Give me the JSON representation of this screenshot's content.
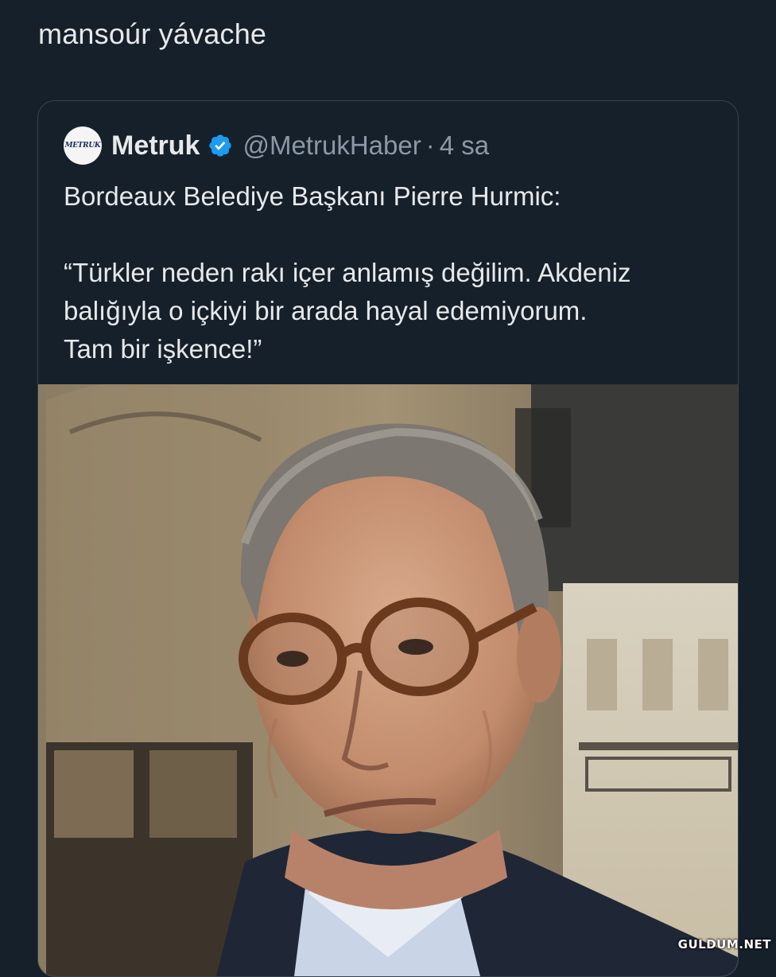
{
  "reply": {
    "text": "mansoúr yávache"
  },
  "quoted_tweet": {
    "avatar_text": "METRUK",
    "display_name": "Metruk",
    "verified": true,
    "handle": "@MetrukHaber",
    "separator": "·",
    "time": "4 sa",
    "lines": [
      "Bordeaux Belediye Başkanı Pierre Hurmic:",
      "“Türkler neden rakı içer anlamış değilim. Akdeniz",
      "balığıyla o içkiyi bir arada hayal edemiyorum.",
      "Tam bir işkence!”"
    ],
    "media": {
      "type": "photo",
      "description_icon": "person-photo"
    }
  },
  "watermark": "GULDUM.NET",
  "colors": {
    "background": "#15202b",
    "text": "#e7e9ea",
    "secondary_text": "#8b98a5",
    "border": "#38444d",
    "verified": "#1d9bf0"
  }
}
